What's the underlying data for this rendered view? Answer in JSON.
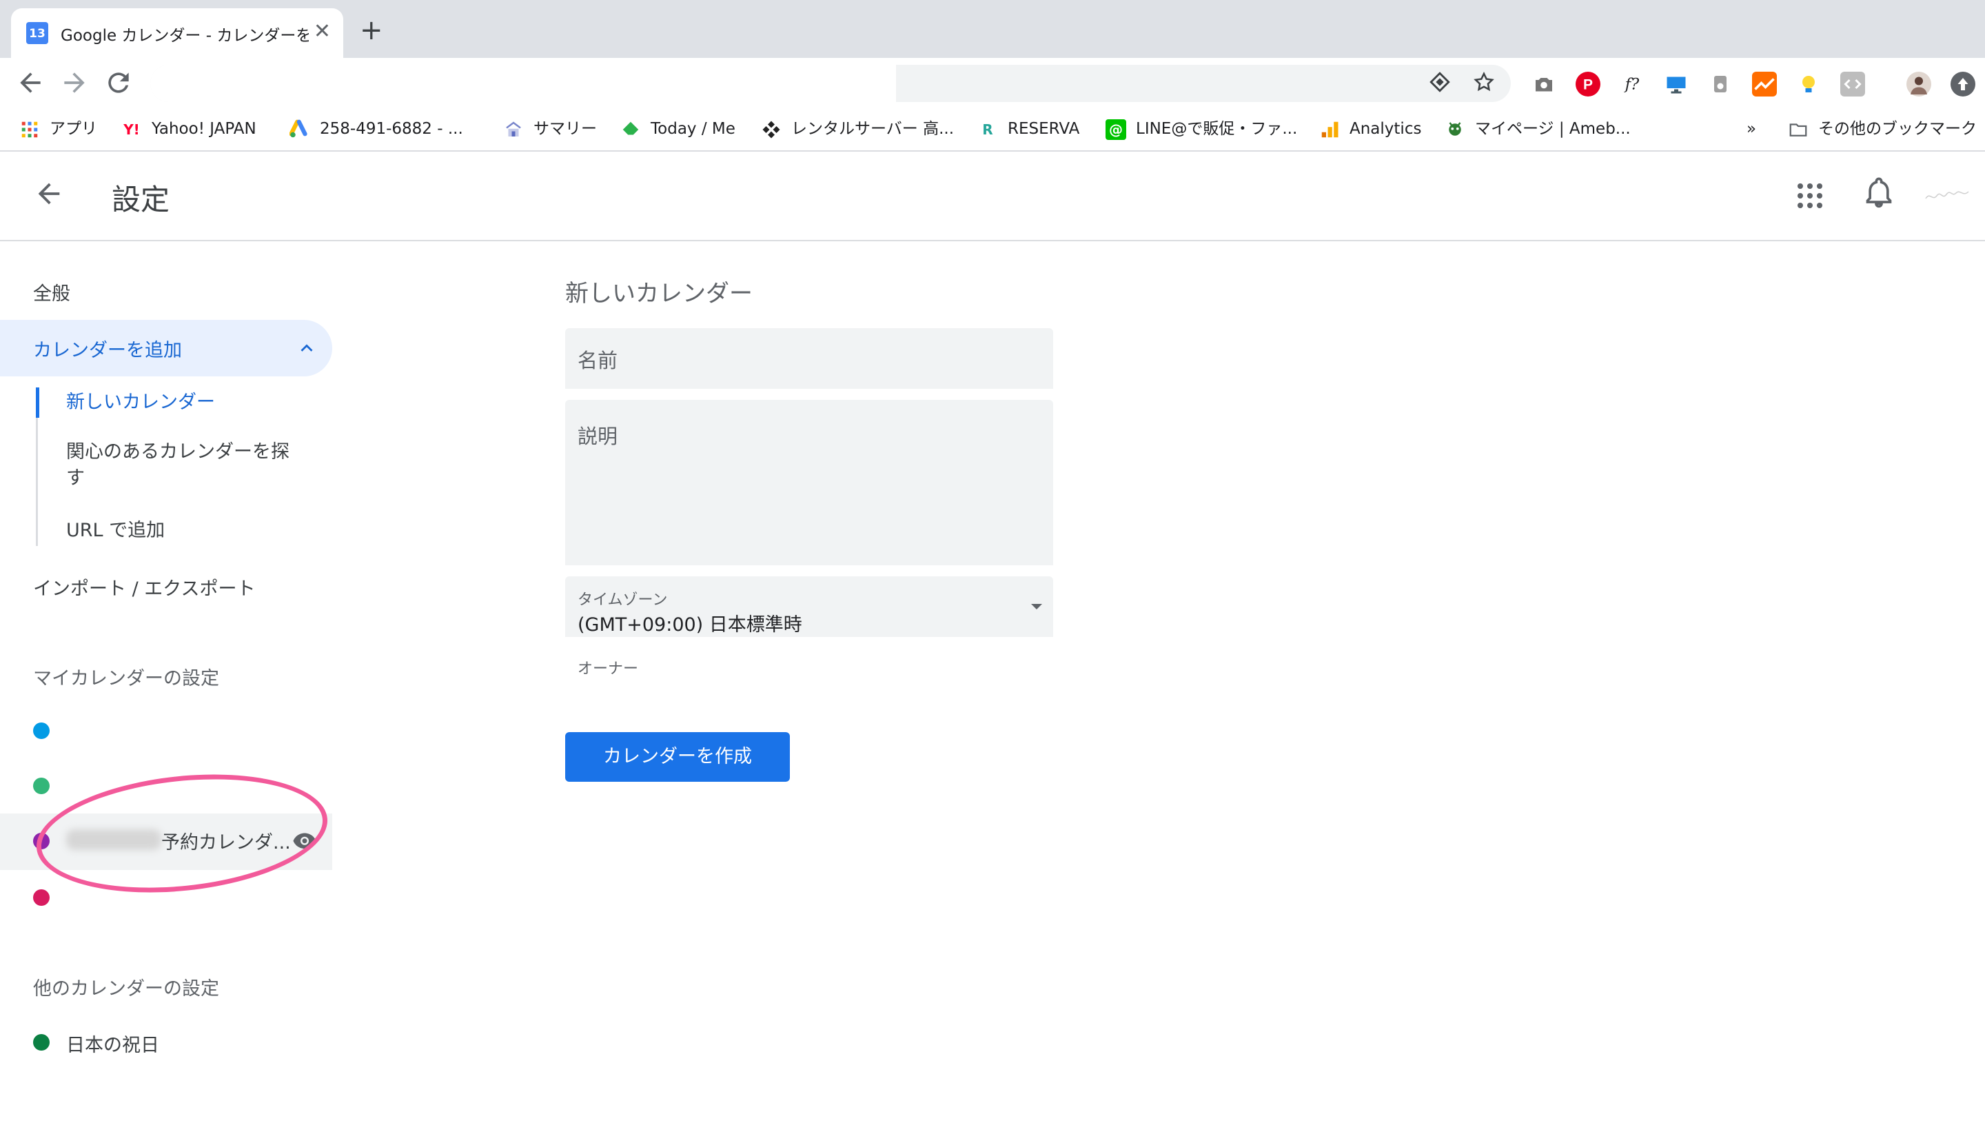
{
  "browser": {
    "tab_title": "Google カレンダー - カレンダーを",
    "tab_favicon_text": "13",
    "close_glyph": "✕",
    "new_tab_glyph": "+",
    "bookmarks": [
      {
        "label": "アプリ",
        "icon": "apps-grid-icon",
        "color": "#4285f4"
      },
      {
        "label": "Yahoo! JAPAN",
        "icon": "yahoo-icon",
        "color": "#ff0033"
      },
      {
        "label": "258-491-6882 - ...",
        "icon": "google-ads-icon",
        "color": "#4285f4"
      },
      {
        "label": "サマリー",
        "icon": "summary-icon",
        "color": "#5c6bc0"
      },
      {
        "label": "Today / Me",
        "icon": "feedly-icon",
        "color": "#2bb24c"
      },
      {
        "label": "レンタルサーバー 高...",
        "icon": "server-icon",
        "color": "#222222"
      },
      {
        "label": "RESERVA",
        "icon": "reserva-icon",
        "color": "#26a69a"
      },
      {
        "label": "LINE@で販促・ファ...",
        "icon": "line-icon",
        "color": "#00c300"
      },
      {
        "label": "Analytics",
        "icon": "analytics-icon",
        "color": "#f9ab00"
      },
      {
        "label": "マイページ | Ameb...",
        "icon": "ameba-icon",
        "color": "#2e7d32"
      }
    ],
    "bookmarks_overflow": "»",
    "other_bookmarks": "その他のブックマーク"
  },
  "header": {
    "title": "設定"
  },
  "sidebar": {
    "general": "全般",
    "add_calendar": "カレンダーを追加",
    "sub_new": "新しいカレンダー",
    "sub_browse_1": "関心のあるカレンダーを探",
    "sub_browse_2": "す",
    "sub_url": "URL で追加",
    "import_export": "インポート / エクスポート",
    "my_calendars_heading": "マイカレンダーの設定",
    "my_calendars": [
      {
        "color": "#039be5"
      },
      {
        "color": "#33b679"
      },
      {
        "color": "#8e24aa",
        "label": "予約カレンダ..."
      },
      {
        "color": "#d81b60"
      }
    ],
    "other_calendars_heading": "他のカレンダーの設定",
    "other_calendars": [
      {
        "color": "#0b8043",
        "label": "日本の祝日"
      }
    ]
  },
  "form": {
    "title": "新しいカレンダー",
    "name_placeholder": "名前",
    "description_placeholder": "説明",
    "timezone_label": "タイムゾーン",
    "timezone_value": "(GMT+09:00) 日本標準時",
    "owner_label": "オーナー",
    "create_button": "カレンダーを作成"
  }
}
